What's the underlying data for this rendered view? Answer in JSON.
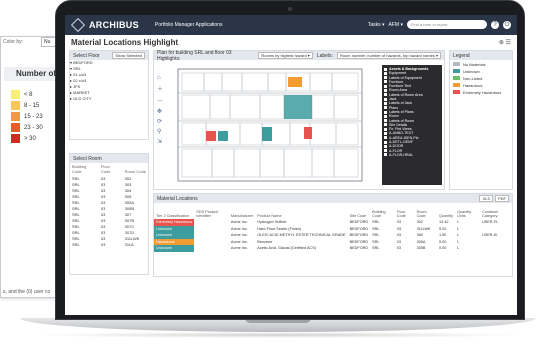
{
  "background_panel": {
    "color_by_label": "Color by:",
    "color_by_value": "Nu",
    "title": "Number of",
    "legend": [
      {
        "label": "< 8",
        "color": "#f7ef7a"
      },
      {
        "label": "8 - 15",
        "color": "#f9c65a"
      },
      {
        "label": "15 - 23",
        "color": "#f59a3c"
      },
      {
        "label": "23 - 30",
        "color": "#ea5a2a"
      },
      {
        "label": "> 30",
        "color": "#d02a22"
      }
    ],
    "footer": "s, and the (0) user co"
  },
  "app": {
    "logo": "ARCHIBUS",
    "nav": "Portfolio Manager    Applications",
    "tasks": "Tasks ▾",
    "user": "AFM ▾",
    "search_placeholder": "Find a form or report",
    "help_icon": "?",
    "title": "Material Locations Highlight",
    "tools": "⊕ ☰"
  },
  "floor_panel": {
    "header": "Select Floor",
    "button": "Show Selected",
    "tree": [
      "▾ BEDFORD",
      "  ▾ SRL",
      "      ▸ 01 c/o3",
      "      ▸ 02 c/o3",
      "▸ JFK",
      "▸ MARKET",
      "▸ OLD CITY"
    ]
  },
  "room_panel": {
    "header": "Select Room",
    "columns": [
      "Building Code",
      "Floor Code",
      "Room Code"
    ],
    "rows": [
      [
        "SRL",
        "03",
        "302"
      ],
      [
        "SRL",
        "03",
        "303"
      ],
      [
        "SRL",
        "03",
        "304"
      ],
      [
        "SRL",
        "03",
        "305"
      ],
      [
        "SRL",
        "03",
        "305A"
      ],
      [
        "SRL",
        "03",
        "305B"
      ],
      [
        "SRL",
        "03",
        "307"
      ],
      [
        "SRL",
        "03",
        "307B"
      ],
      [
        "SRL",
        "03",
        "307C"
      ],
      [
        "SRL",
        "03",
        "307D"
      ],
      [
        "SRL",
        "03",
        "311LWK"
      ],
      [
        "SRL",
        "03",
        "311A"
      ]
    ]
  },
  "plan_panel": {
    "header": "Plan for building SRL and floor 03  Highlights:",
    "highlight_select": "Rooms by highest hazard ▾",
    "labels": "Labels:",
    "labels_select": "Room number, number of hazards, top hazard names ▾",
    "tools": [
      "⌂",
      "＋",
      "－",
      "✥",
      "⟳",
      "⚲",
      "⇲"
    ],
    "layers": [
      "Assets & Backgrounds",
      "Equipment",
      "Labels of Equipment",
      "Furniture",
      "Furniture Text",
      "Room Area",
      "Labels of Room Area",
      "Jack",
      "Labels of Jack",
      "Plans",
      "Labels of Plans",
      "Room",
      "Labels of Room",
      "Site Details",
      "Fir. Flrd Views",
      "A-ANNO-TEXT",
      "A-AREA-IDEN-Plo",
      "A-DETL-GENF",
      "A-DOOR",
      "A-FLOR",
      "A-FLOR-HRAL"
    ]
  },
  "legend_panel": {
    "header": "Legend",
    "items": [
      {
        "label": "No Materials",
        "color": "#b3b8bf"
      },
      {
        "label": "Unknown",
        "color": "#3d9c9d"
      },
      {
        "label": "Non-Listed",
        "color": "#6abf69"
      },
      {
        "label": "Hazardous",
        "color": "#f39c34"
      },
      {
        "label": "Extremely Hazardous",
        "color": "#e8534d"
      }
    ]
  },
  "materials_panel": {
    "header": "Material Locations",
    "buttons": [
      "XLS",
      "PDF"
    ],
    "columns": [
      "Tier 2 Classification",
      "SDS Product Identifier",
      "Manufacturer",
      "Product Name",
      "Site Code",
      "Building Code",
      "Floor Code",
      "Room Code",
      "Quantity",
      "Quantity Units",
      "Container Category"
    ],
    "rows": [
      {
        "class": "Extremely Hazardous",
        "color": "#e8534d",
        "cells": [
          "",
          "Acme Inc.",
          "Hydrogen Sulfide",
          "BEDFORD",
          "SRL",
          "03",
          "302",
          "13.42",
          "L",
          "USER-FL"
        ]
      },
      {
        "class": "Unknown",
        "color": "#3d9c9d",
        "cells": [
          "",
          "Acme Inc.",
          "Hard Floor Sealer (Finish)",
          "BEDFORD",
          "SRL",
          "03",
          "311LWK",
          "5.00",
          "L",
          ""
        ]
      },
      {
        "class": "Unknown",
        "color": "#3d9c9d",
        "cells": [
          "",
          "Acme Inc.",
          "OLEIC ACID METHYL ESTER TECHNICAL GRADE",
          "BEDFORD",
          "SRL",
          "03",
          "360",
          "1.50",
          "L",
          "USER-KI"
        ]
      },
      {
        "class": "Hazardous",
        "color": "#f39c34",
        "cells": [
          "",
          "Acme Inc.",
          "Benzene",
          "BEDFORD",
          "SRL",
          "03",
          "305A",
          "5.00",
          "L",
          ""
        ]
      },
      {
        "class": "Unknown",
        "color": "#3d9c9d",
        "cells": [
          "",
          "Acme Inc.",
          "Acetic Acid, Glacial (Certified ACS)",
          "BEDFORD",
          "SRL",
          "03",
          "305B",
          "0.00",
          "L",
          ""
        ]
      }
    ]
  }
}
